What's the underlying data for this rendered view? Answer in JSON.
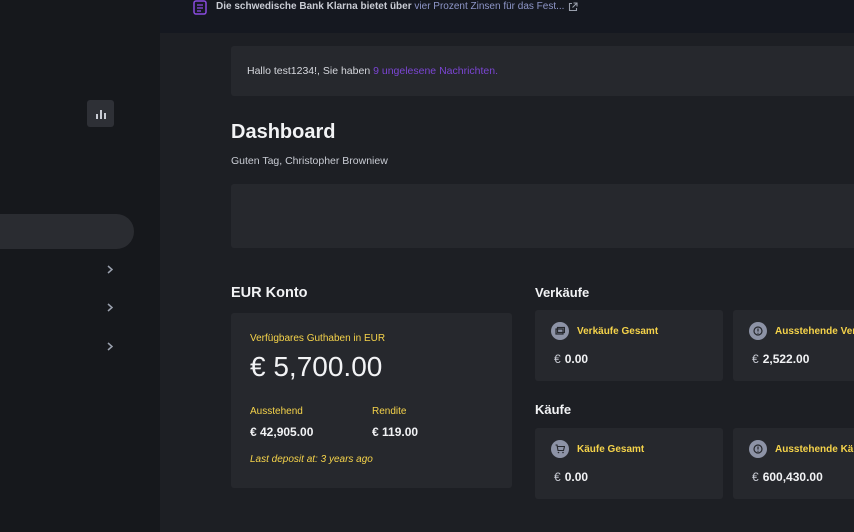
{
  "announcement": {
    "bold_text": "Die schwedische Bank Klarna bietet über",
    "link_text": "vier Prozent Zinsen für das Fest..."
  },
  "message_bar": {
    "prefix": "Hallo test1234!, Sie haben",
    "link": "9 ungelesene Nachrichten."
  },
  "page": {
    "title": "Dashboard",
    "greeting": "Guten Tag, Christopher Browniew"
  },
  "account": {
    "section_title": "EUR Konto",
    "available_label": "Verfügbares Guthaben in EUR",
    "available_value": "€ 5,700.00",
    "pending_label": "Ausstehend",
    "pending_value": "€ 42,905.00",
    "yield_label": "Rendite",
    "yield_value": "€ 119.00",
    "last_deposit": "Last deposit at: 3 years ago"
  },
  "sales": {
    "section_title": "Verkäufe",
    "total_label": "Verkäufe Gesamt",
    "total_currency": "€",
    "total_value": "0.00",
    "pending_label": "Ausstehende Verk",
    "pending_currency": "€",
    "pending_value": "2,522.00"
  },
  "purchases": {
    "section_title": "Käufe",
    "total_label": "Käufe Gesamt",
    "total_currency": "€",
    "total_value": "0.00",
    "pending_label": "Ausstehende Käu",
    "pending_currency": "€",
    "pending_value": "600,430.00"
  },
  "icons": {
    "sidebar_button": "bar-chart-icon",
    "announcement": "news-icon",
    "external": "external-link-icon"
  },
  "colors": {
    "accent_purple": "#7b45d4",
    "label_yellow": "#f5d34a",
    "card_bg": "#26282d",
    "page_bg": "#1d1f24"
  }
}
